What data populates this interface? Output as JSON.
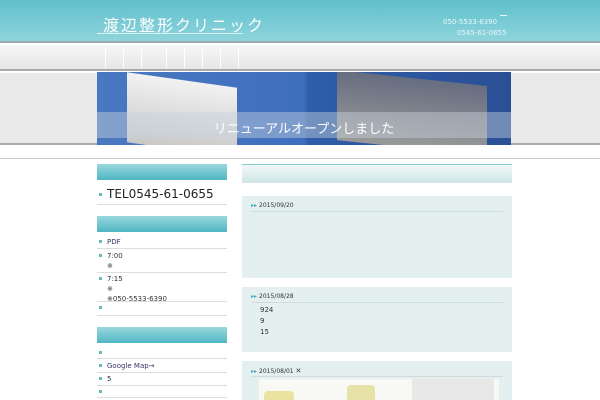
{
  "header": {
    "title": "渡辺整形クリニック",
    "tel1": "050-5533-6390",
    "tel2": "0545-61-0655"
  },
  "hero": {
    "caption": "リニューアルオープンしました"
  },
  "sidebar": {
    "tel": "TEL0545-61-0655",
    "group1": [
      {
        "line1": "PDF"
      },
      {
        "line1": "7:00",
        "line2": "※"
      },
      {
        "line1": "7:15",
        "line2": "※",
        "line3": "※050-5533-6390"
      },
      {
        "line1": ""
      }
    ],
    "group2": [
      {
        "line1": ""
      },
      {
        "line1": "Google Map→"
      },
      {
        "line1": "5"
      },
      {
        "line1": ""
      }
    ]
  },
  "posts": [
    {
      "date": "2015/09/20",
      "lines": []
    },
    {
      "date": "2015/08/28",
      "lines": [
        "924",
        "9",
        "15"
      ]
    },
    {
      "date": "2015/08/01",
      "mark": "✕"
    }
  ]
}
